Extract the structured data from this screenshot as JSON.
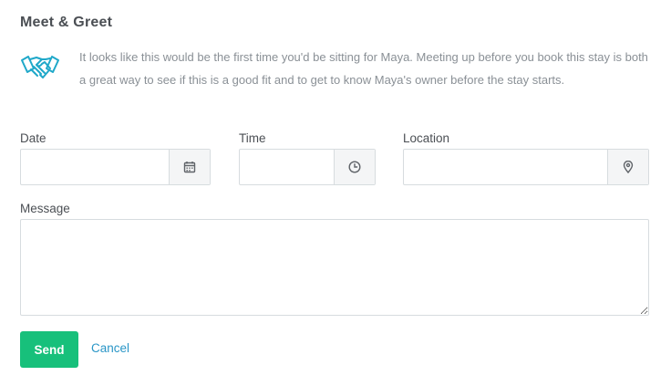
{
  "section": {
    "title": "Meet & Greet",
    "intro": "It looks like this would be the first time you'd be sitting for Maya. Meeting up before you book this stay is both a great way to see if this is a good fit and to get to know Maya's owner before the stay starts.",
    "icon": "handshake-icon",
    "accent_color": "#1fa8c9"
  },
  "form": {
    "date": {
      "label": "Date",
      "value": "",
      "placeholder": "",
      "icon": "calendar-icon"
    },
    "time": {
      "label": "Time",
      "value": "",
      "placeholder": "",
      "icon": "clock-icon"
    },
    "location": {
      "label": "Location",
      "value": "",
      "placeholder": "",
      "icon": "map-pin-icon"
    },
    "message": {
      "label": "Message",
      "value": "",
      "placeholder": ""
    }
  },
  "actions": {
    "send_label": "Send",
    "cancel_label": "Cancel",
    "send_color": "#17c07b",
    "cancel_color": "#2a96c7"
  }
}
